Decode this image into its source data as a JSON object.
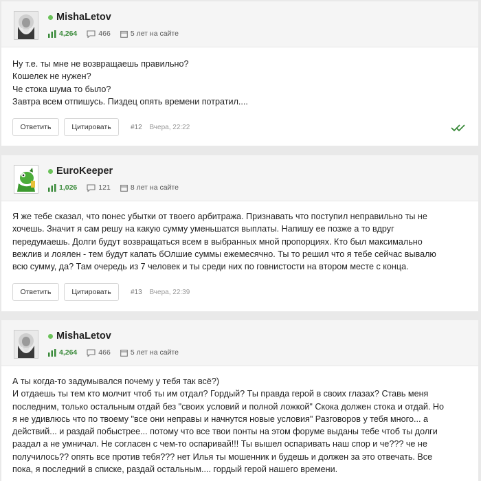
{
  "posts": [
    {
      "username": "MishaLetov",
      "rating": "4,264",
      "comments": "466",
      "member_since": "5 лет на сайте",
      "text": [
        "Ну т.е. ты мне не возвращаешь правильно?",
        "Кошелек не нужен?",
        "Че стока шума то было?",
        "Завтра всем отпишусь.  Пиздец опять времени потратил...."
      ],
      "reply_label": "Ответить",
      "quote_label": "Цитировать",
      "post_number": "#12",
      "timestamp": "Вчера, 22:22"
    },
    {
      "username": "EuroKeeper",
      "rating": "1,026",
      "comments": "121",
      "member_since": "8 лет на сайте",
      "text": [
        "Я же тебе сказал, что понес убытки от твоего арбитража. Признавать что поступил неправильно ты не",
        "хочешь. Значит я сам решу на какую сумму уменьшатся выплаты. Напишу ее позже а то вдруг",
        "передумаешь. Долги будут возвращаться всем в выбранных мной пропорциях. Кто был максимально",
        "вежлив и лоялен - тем будут капать бОлшие суммы ежемесячно. Ты то решил что я тебе сейчас вывалю",
        "всю сумму, да? Там очередь из 7 человек и ты среди них по говнистости на втором месте с конца."
      ],
      "reply_label": "Ответить",
      "quote_label": "Цитировать",
      "post_number": "#13",
      "timestamp": "Вчера, 22:39"
    },
    {
      "username": "MishaLetov",
      "rating": "4,264",
      "comments": "466",
      "member_since": "5 лет на сайте",
      "text": [
        "А ты когда-то задумывался почему у тебя так всё?)",
        "И отдаешь ты тем кто молчит чтоб ты им отдал? Гордый? Ты правда герой в своих глазах? Ставь меня",
        "последним, только остальным отдай без \"своих условий и полной ложкой\" Скока должен стока и отдай. Но",
        "я не удивлюсь что по твоему \"все они неправы и начнутся новые условия\" Разговоров у тебя много... а",
        "действий... и раздай побыстрее... потому что все твои понты на этом форуме выданы тебе чтоб ты долги",
        "раздал а не умничал. Не согласен с чем-то оспаривай!!! Ты вышел оспаривать наш спор и че??? че не",
        "получилось?? опять все против тебя??? нет Илья ты мошенник и будешь и должен за это отвечать. Все",
        "пока, я последний в списке, раздай остальным.... гордый герой нашего времени."
      ]
    }
  ],
  "colors": {
    "accent_green": "#3a8a3a",
    "online_dot": "#6ac259",
    "header_bg": "#f5f5f5",
    "page_bg": "#e9e9e9"
  }
}
